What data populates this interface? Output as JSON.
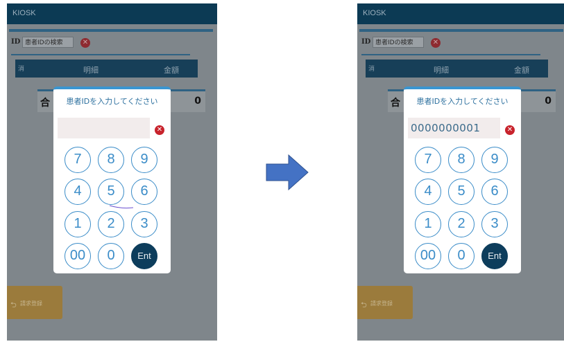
{
  "screens": [
    {
      "app_title": "KIOSK",
      "id_label": "ID",
      "id_placeholder": "患者IDの検索",
      "table_headers": [
        "消",
        "明細",
        "金額"
      ],
      "sum_label": "合",
      "sum_value": "0",
      "register_button": "請求登録",
      "modal_title": "患者IDを入力してください",
      "input_value": "",
      "keys": [
        "7",
        "8",
        "9",
        "4",
        "5",
        "6",
        "1",
        "2",
        "3",
        "00",
        "0",
        "Ent"
      ]
    },
    {
      "app_title": "KIOSK",
      "id_label": "ID",
      "id_placeholder": "患者IDの検索",
      "table_headers": [
        "消",
        "明細",
        "金額"
      ],
      "sum_label": "合",
      "sum_value": "0",
      "register_button": "請求登録",
      "modal_title": "患者IDを入力してください",
      "input_value": "0000000001",
      "keys": [
        "7",
        "8",
        "9",
        "4",
        "5",
        "6",
        "1",
        "2",
        "3",
        "00",
        "0",
        "Ent"
      ]
    }
  ],
  "icons": {
    "clear": "close-icon",
    "register": "return-icon",
    "transition": "right-arrow-icon"
  },
  "colors": {
    "header": "#0c3a54",
    "modal_accent": "#3a95d0",
    "key_outline": "#3a8cc8",
    "enter_key": "#0d3d5c",
    "arrow": "#4472c4",
    "clear_icon": "#c8232c"
  }
}
